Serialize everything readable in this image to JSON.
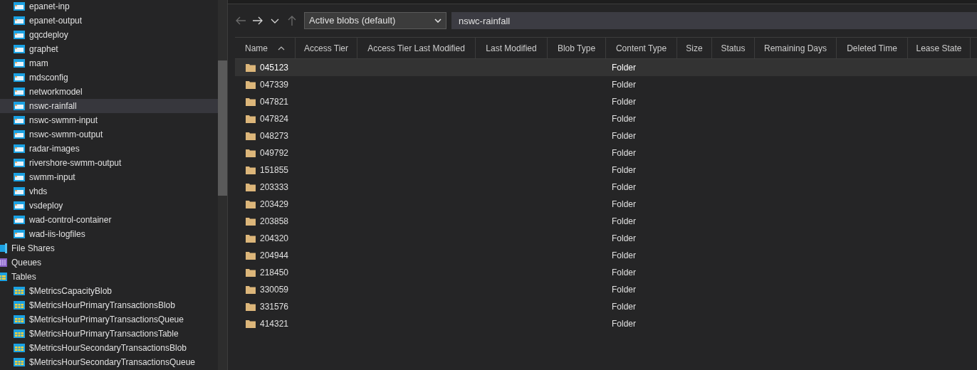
{
  "sidebar": {
    "blob_containers": [
      {
        "label": "epanet-inp",
        "selected": false
      },
      {
        "label": "epanet-output",
        "selected": false
      },
      {
        "label": "gqcdeploy",
        "selected": false
      },
      {
        "label": "graphet",
        "selected": false
      },
      {
        "label": "mam",
        "selected": false
      },
      {
        "label": "mdsconfig",
        "selected": false
      },
      {
        "label": "networkmodel",
        "selected": false
      },
      {
        "label": "nswc-rainfall",
        "selected": true
      },
      {
        "label": "nswc-swmm-input",
        "selected": false
      },
      {
        "label": "nswc-swmm-output",
        "selected": false
      },
      {
        "label": "radar-images",
        "selected": false
      },
      {
        "label": "rivershore-swmm-output",
        "selected": false
      },
      {
        "label": "swmm-input",
        "selected": false
      },
      {
        "label": "vhds",
        "selected": false
      },
      {
        "label": "vsdeploy",
        "selected": false
      },
      {
        "label": "wad-control-container",
        "selected": false
      },
      {
        "label": "wad-iis-logfiles",
        "selected": false
      }
    ],
    "categories": [
      {
        "label": "File Shares",
        "kind": "file-shares"
      },
      {
        "label": "Queues",
        "kind": "queues"
      },
      {
        "label": "Tables",
        "kind": "tables",
        "children": [
          {
            "label": "$MetricsCapacityBlob"
          },
          {
            "label": "$MetricsHourPrimaryTransactionsBlob"
          },
          {
            "label": "$MetricsHourPrimaryTransactionsQueue"
          },
          {
            "label": "$MetricsHourPrimaryTransactionsTable"
          },
          {
            "label": "$MetricsHourSecondaryTransactionsBlob"
          },
          {
            "label": "$MetricsHourSecondaryTransactionsQueue"
          }
        ]
      }
    ]
  },
  "toolbar": {
    "nav": [
      {
        "kind": "back",
        "disabled": true
      },
      {
        "kind": "forward",
        "disabled": false
      },
      {
        "kind": "recent",
        "disabled": false
      },
      {
        "kind": "up",
        "disabled": true
      }
    ],
    "view_select": {
      "value": "Active blobs (default)"
    },
    "path_field": {
      "value": "nswc-rainfall"
    }
  },
  "table": {
    "columns": [
      {
        "label": "Name",
        "sorted": true
      },
      {
        "label": "Access Tier",
        "sorted": false
      },
      {
        "label": "Access Tier Last Modified",
        "sorted": false
      },
      {
        "label": "Last Modified",
        "sorted": false
      },
      {
        "label": "Blob Type",
        "sorted": false
      },
      {
        "label": "Content Type",
        "sorted": false
      },
      {
        "label": "Size",
        "sorted": false
      },
      {
        "label": "Status",
        "sorted": false
      },
      {
        "label": "Remaining Days",
        "sorted": false
      },
      {
        "label": "Deleted Time",
        "sorted": false
      },
      {
        "label": "Lease State",
        "sorted": false
      }
    ],
    "rows": [
      {
        "name": "045123",
        "content_type": "Folder",
        "selected": true
      },
      {
        "name": "047339",
        "content_type": "Folder",
        "selected": false
      },
      {
        "name": "047821",
        "content_type": "Folder",
        "selected": false
      },
      {
        "name": "047824",
        "content_type": "Folder",
        "selected": false
      },
      {
        "name": "048273",
        "content_type": "Folder",
        "selected": false
      },
      {
        "name": "049792",
        "content_type": "Folder",
        "selected": false
      },
      {
        "name": "151855",
        "content_type": "Folder",
        "selected": false
      },
      {
        "name": "203333",
        "content_type": "Folder",
        "selected": false
      },
      {
        "name": "203429",
        "content_type": "Folder",
        "selected": false
      },
      {
        "name": "203858",
        "content_type": "Folder",
        "selected": false
      },
      {
        "name": "204320",
        "content_type": "Folder",
        "selected": false
      },
      {
        "name": "204944",
        "content_type": "Folder",
        "selected": false
      },
      {
        "name": "218450",
        "content_type": "Folder",
        "selected": false
      },
      {
        "name": "330059",
        "content_type": "Folder",
        "selected": false
      },
      {
        "name": "331576",
        "content_type": "Folder",
        "selected": false
      },
      {
        "name": "414321",
        "content_type": "Folder",
        "selected": false
      }
    ]
  }
}
